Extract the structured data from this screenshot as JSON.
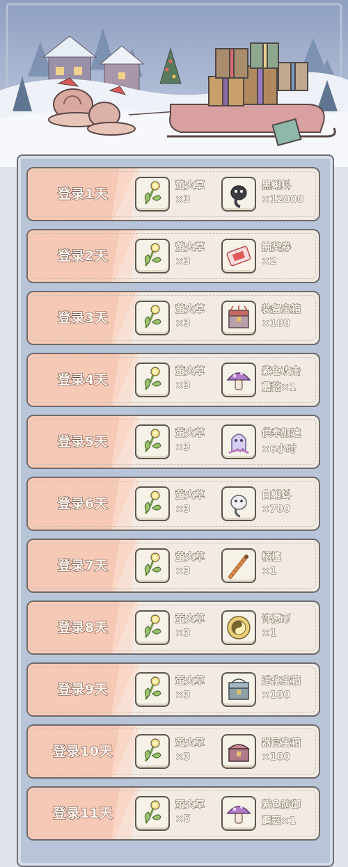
{
  "rewards": [
    {
      "day": "登录1天",
      "r1": {
        "name": "萤火草",
        "count": "×3",
        "icon": "firefly-grass-icon"
      },
      "r2": {
        "name": "黑蝌蚪",
        "count": "×12000",
        "icon": "black-tadpole-icon"
      }
    },
    {
      "day": "登录2天",
      "r1": {
        "name": "萤火草",
        "count": "×3",
        "icon": "firefly-grass-icon"
      },
      "r2": {
        "name": "抽奖券",
        "count": "×2",
        "icon": "lottery-ticket-icon"
      }
    },
    {
      "day": "登录3天",
      "r1": {
        "name": "萤火草",
        "count": "×3",
        "icon": "firefly-grass-icon"
      },
      "r2": {
        "name": "装备宝箱",
        "count": "×100",
        "icon": "equipment-chest-icon"
      }
    },
    {
      "day": "登录4天",
      "r1": {
        "name": "萤火草",
        "count": "×3",
        "icon": "firefly-grass-icon"
      },
      "r2": {
        "name": "紫色攻击",
        "count": "蘑菇×1",
        "icon": "purple-mushroom-icon"
      }
    },
    {
      "day": "登录5天",
      "r1": {
        "name": "萤火草",
        "count": "×3",
        "icon": "firefly-grass-icon"
      },
      "r2": {
        "name": "供奉加速",
        "count": "×6小时",
        "icon": "offering-ghost-icon"
      }
    },
    {
      "day": "登录6天",
      "r1": {
        "name": "萤火草",
        "count": "×3",
        "icon": "firefly-grass-icon"
      },
      "r2": {
        "name": "白蝌蚪",
        "count": "×700",
        "icon": "white-tadpole-icon"
      }
    },
    {
      "day": "登录7天",
      "r1": {
        "name": "萤火草",
        "count": "×3",
        "icon": "firefly-grass-icon"
      },
      "r2": {
        "name": "柄檀",
        "count": "×1",
        "icon": "incense-stick-icon"
      }
    },
    {
      "day": "登录8天",
      "r1": {
        "name": "萤火草",
        "count": "×3",
        "icon": "firefly-grass-icon"
      },
      "r2": {
        "name": "许愿币",
        "count": "×1",
        "icon": "wish-coin-icon"
      }
    },
    {
      "day": "登录9天",
      "r1": {
        "name": "萤火草",
        "count": "×3",
        "icon": "firefly-grass-icon"
      },
      "r2": {
        "name": "进化宝箱",
        "count": "×100",
        "icon": "evolution-chest-icon"
      }
    },
    {
      "day": "登录10天",
      "r1": {
        "name": "萤火草",
        "count": "×3",
        "icon": "firefly-grass-icon"
      },
      "r2": {
        "name": "器官宝箱",
        "count": "×100",
        "icon": "organ-chest-icon"
      }
    },
    {
      "day": "登录11天",
      "r1": {
        "name": "萤火草",
        "count": "×5",
        "icon": "firefly-grass-icon"
      },
      "r2": {
        "name": "紫色防御",
        "count": "蘑菇×1",
        "icon": "purple-mushroom-icon"
      }
    }
  ],
  "colors": {
    "day_band": "#f6c9b6",
    "row_bg": "#f1ebe4",
    "board_bg": "#b8c4d8"
  }
}
